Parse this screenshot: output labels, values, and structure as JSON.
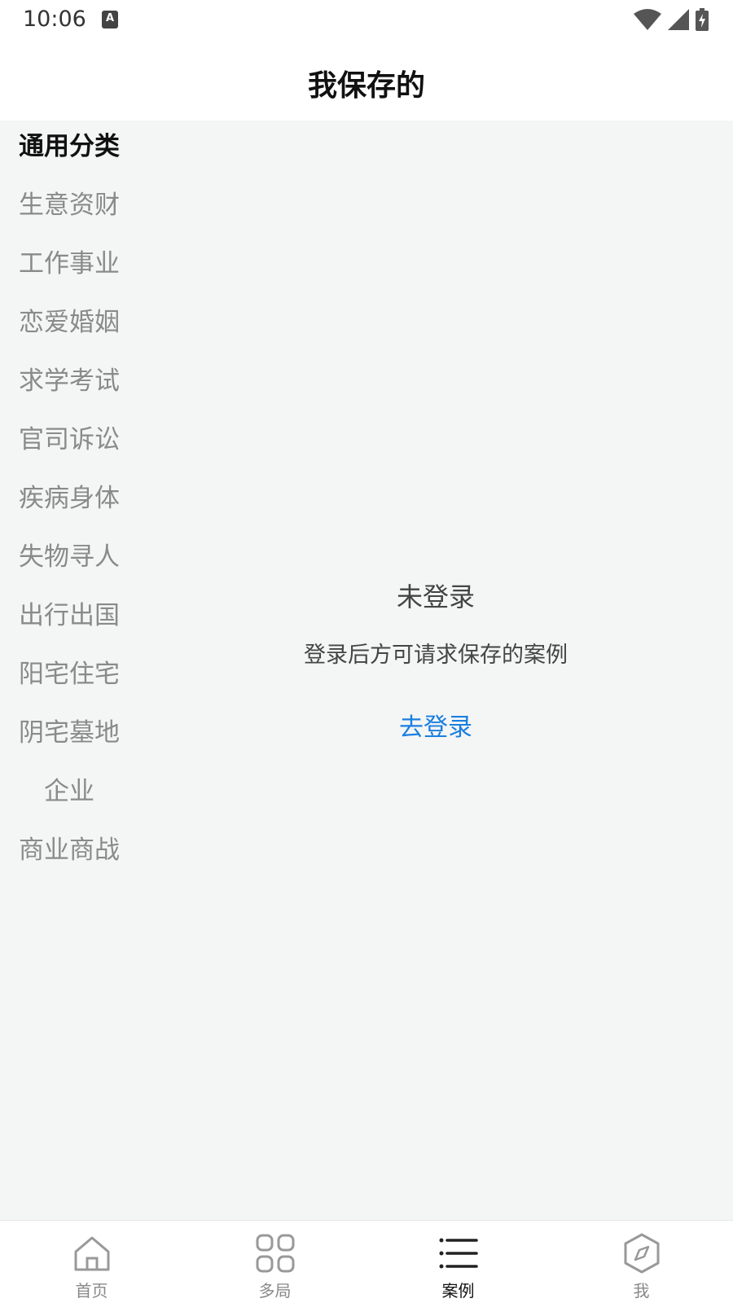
{
  "status": {
    "time": "10:06",
    "a_badge": "A"
  },
  "header": {
    "title": "我保存的"
  },
  "categories": [
    "通用分类",
    "生意资财",
    "工作事业",
    "恋爱婚姻",
    "求学考试",
    "官司诉讼",
    "疾病身体",
    "失物寻人",
    "出行出国",
    "阳宅住宅",
    "阴宅墓地",
    "企业",
    "商业商战"
  ],
  "active_category": "通用分类",
  "empty": {
    "title": "未登录",
    "description": "登录后方可请求保存的案例",
    "login_link": "去登录"
  },
  "tabbar": {
    "items": [
      {
        "label": "首页",
        "icon": "home-icon"
      },
      {
        "label": "多局",
        "icon": "grid-icon"
      },
      {
        "label": "案例",
        "icon": "list-icon"
      },
      {
        "label": "我",
        "icon": "compass-icon"
      }
    ],
    "active": "案例"
  },
  "colors": {
    "accent": "#1a7fe0",
    "background": "#f4f6f5"
  }
}
